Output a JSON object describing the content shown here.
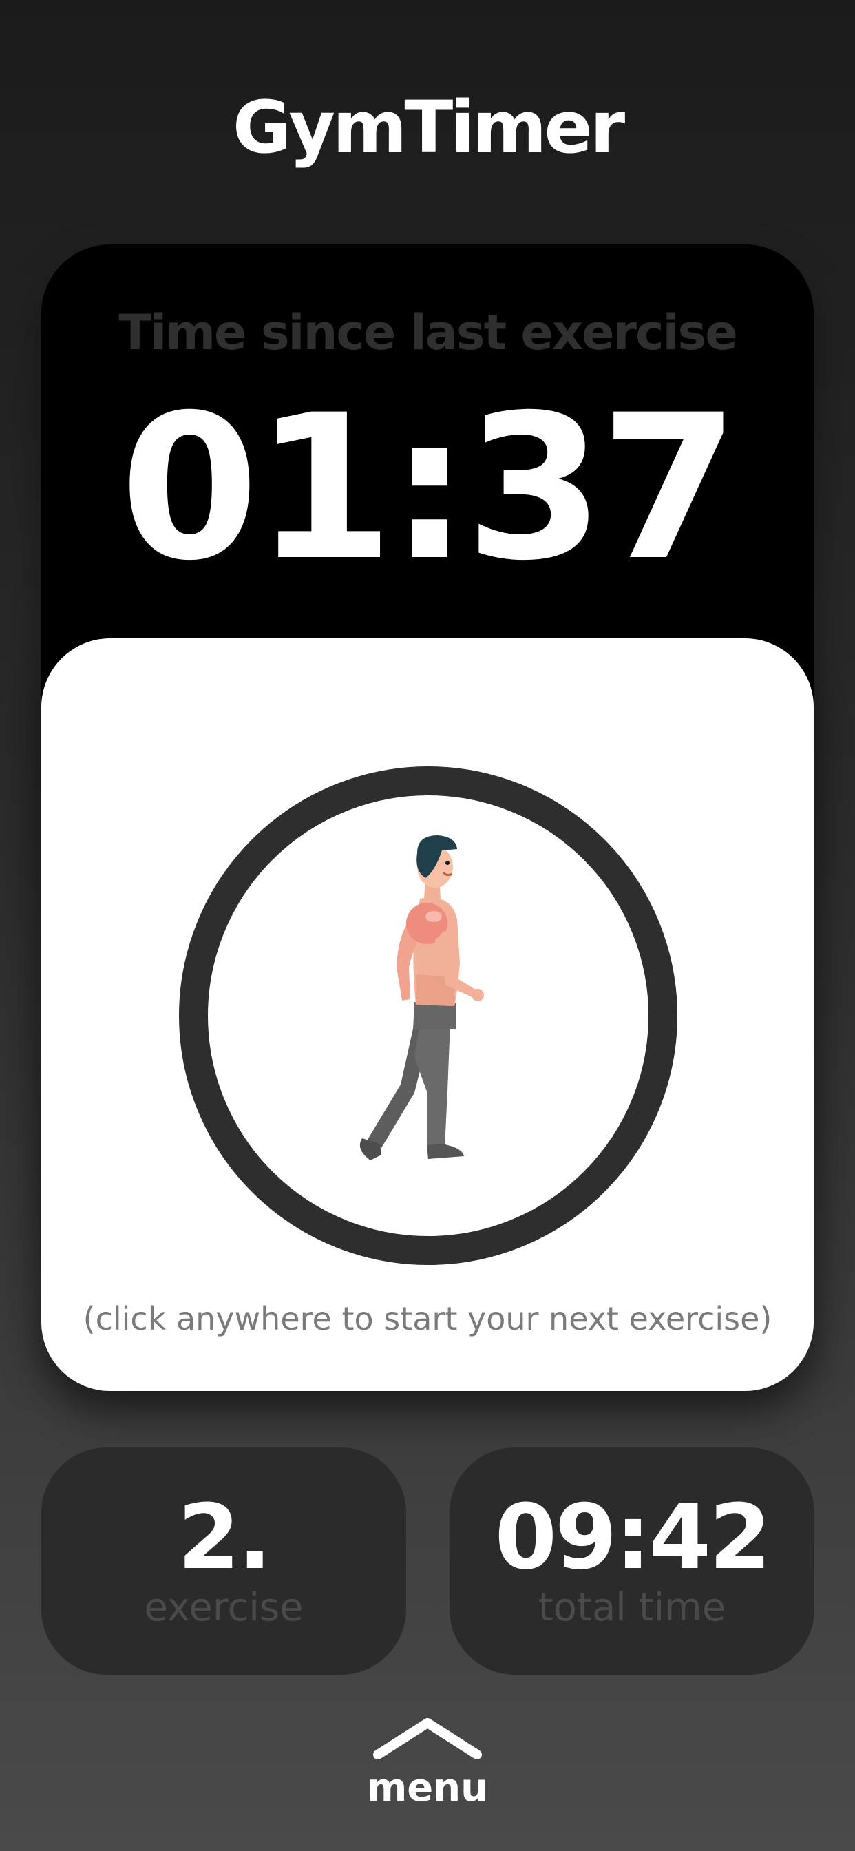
{
  "app": {
    "title": "GymTimer"
  },
  "timer": {
    "label": "Time since last exercise",
    "value": "01:37"
  },
  "start_panel": {
    "illustration": "walking-man-icon",
    "hint": "(click anywhere to start your next exercise)"
  },
  "stats": {
    "exercise": {
      "value": "2.",
      "label": "exercise"
    },
    "total_time": {
      "value": "09:42",
      "label": "total time"
    }
  },
  "menu": {
    "label": "menu",
    "icon": "chevron-up-icon"
  },
  "colors": {
    "background_top": "#1b1b1b",
    "background_bottom": "#4a4a4a",
    "timer_card": "#000000",
    "panel": "#ffffff",
    "ring": "#2e2e2e",
    "stat_card": "#2b2b2b",
    "label_muted": "#4a4a4a"
  }
}
